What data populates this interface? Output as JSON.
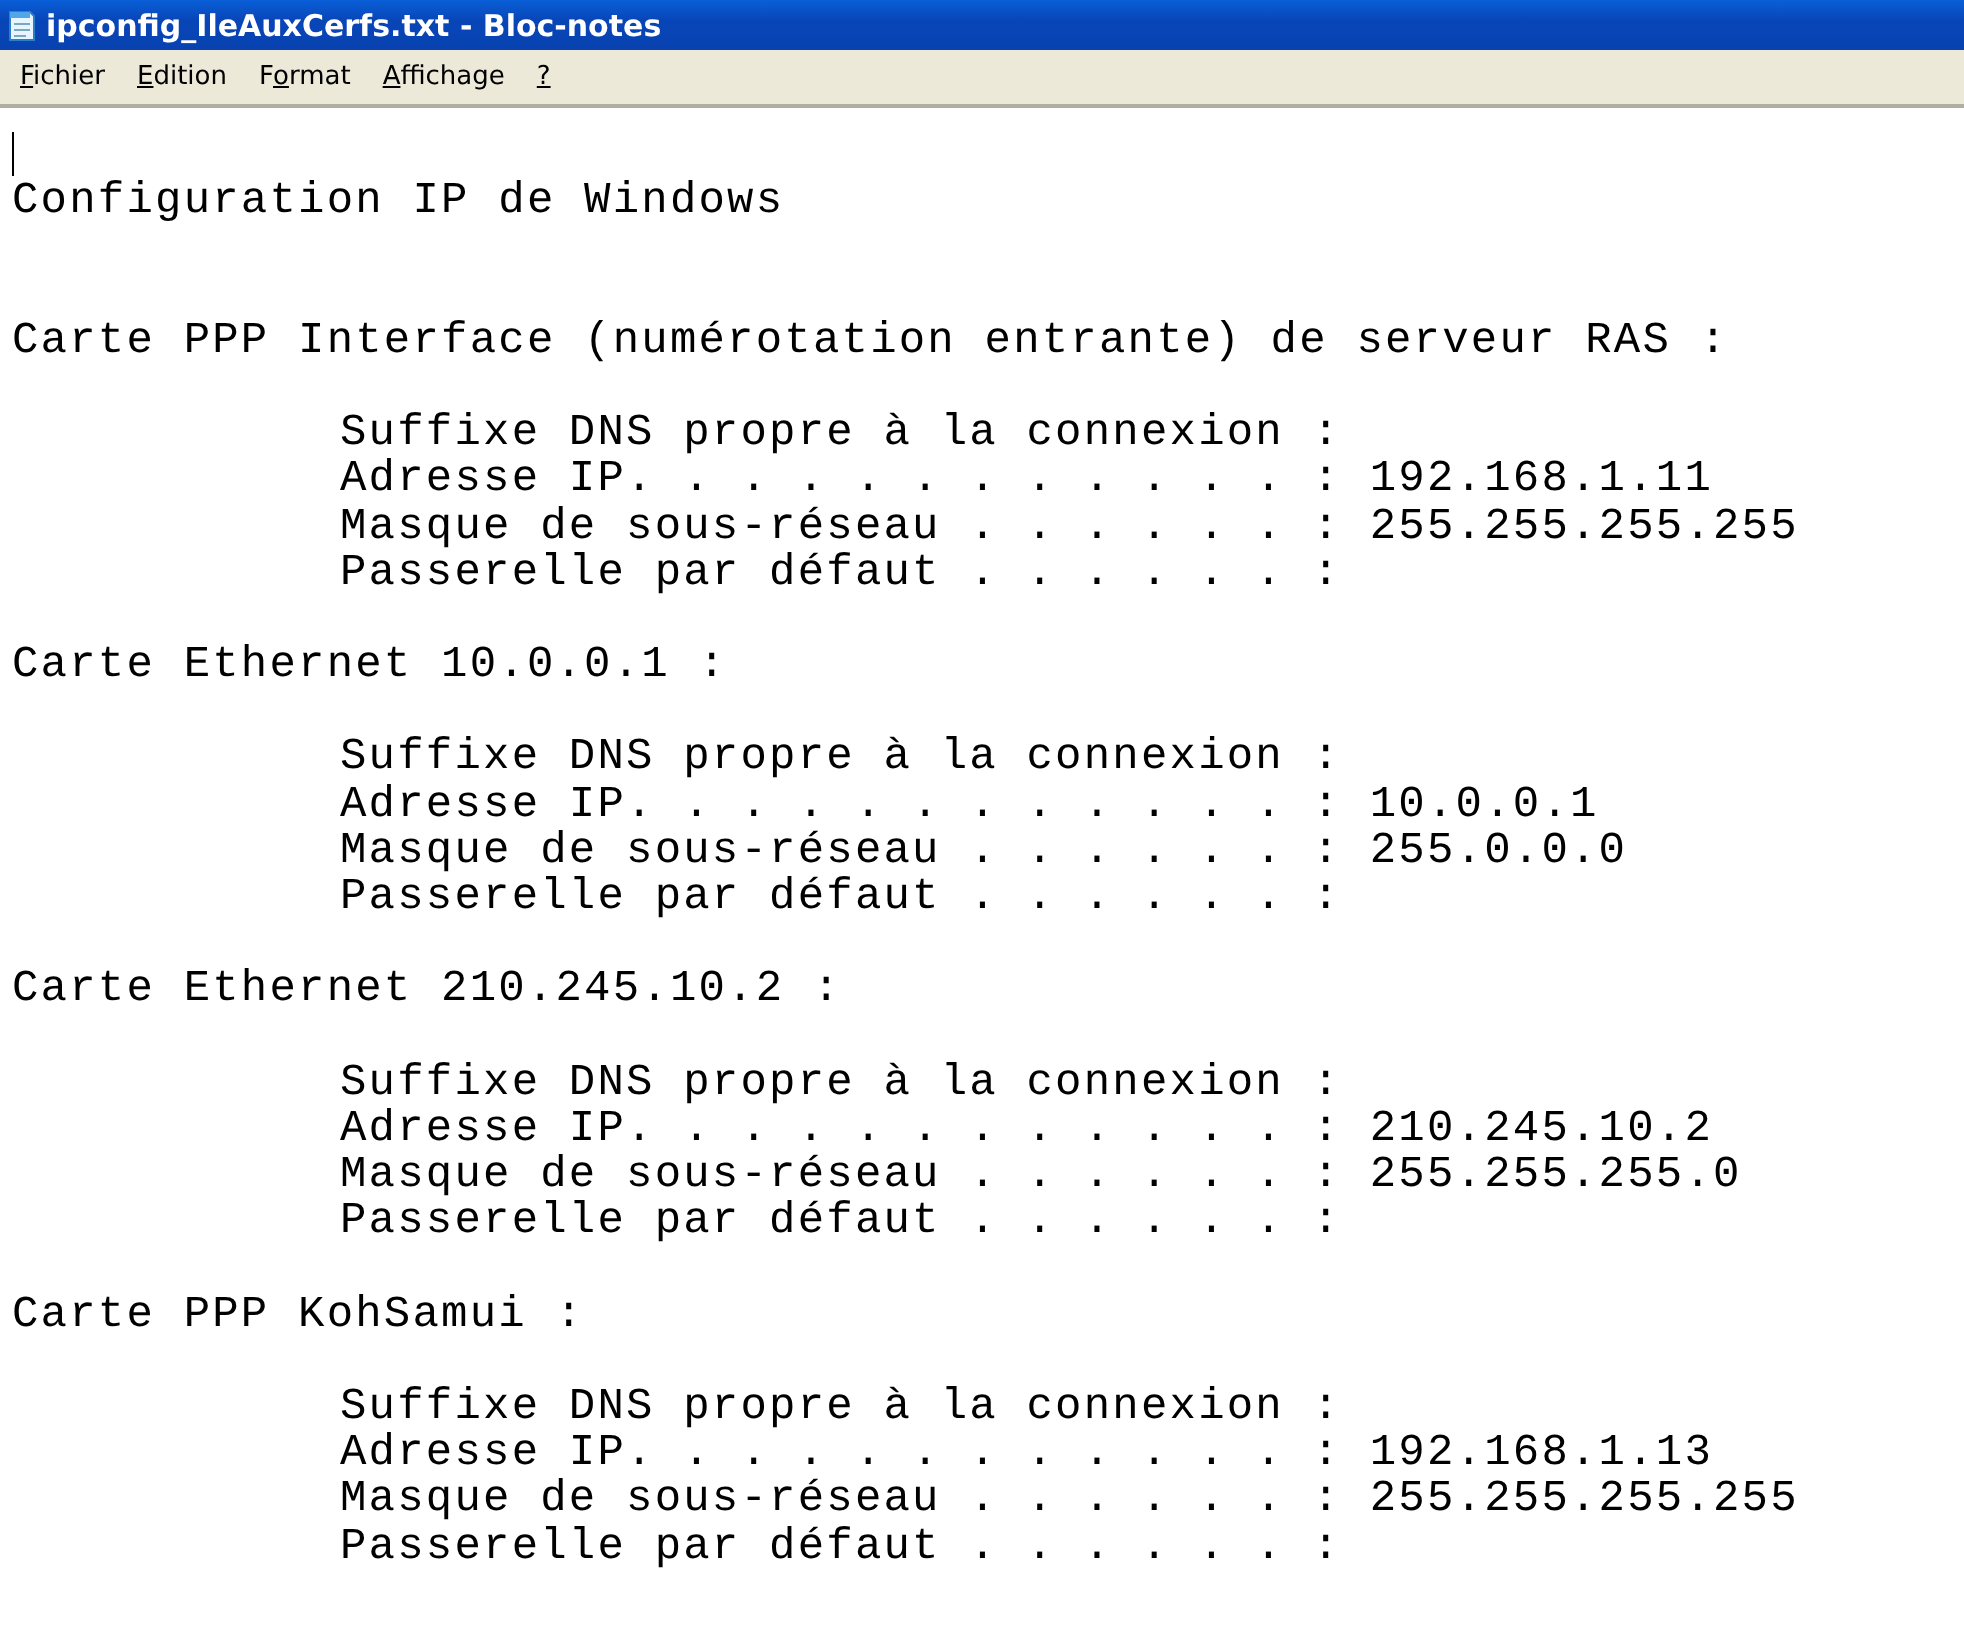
{
  "window": {
    "title": "ipconfig_IleAuxCerfs.txt - Bloc-notes"
  },
  "menu": [
    {
      "key": "F",
      "rest": "ichier"
    },
    {
      "key": "E",
      "rest": "dition"
    },
    {
      "pre": "F",
      "key": "o",
      "rest": "rmat"
    },
    {
      "key": "A",
      "rest": "ffichage"
    },
    {
      "key": "?"
    }
  ],
  "document": {
    "heading": "Configuration IP de Windows",
    "sections": [
      {
        "title": "Carte PPP Interface (numérotation entrante) de serveur RAS :",
        "lines": [
          "Suffixe DNS propre à la connexion :",
          "Adresse IP. . . . . . . . . . . . : 192.168.1.11",
          "Masque de sous-réseau . . . . . . : 255.255.255.255",
          "Passerelle par défaut . . . . . . :"
        ]
      },
      {
        "title": "Carte Ethernet 10.0.0.1 :",
        "lines": [
          "Suffixe DNS propre à la connexion :",
          "Adresse IP. . . . . . . . . . . . : 10.0.0.1",
          "Masque de sous-réseau . . . . . . : 255.0.0.0",
          "Passerelle par défaut . . . . . . :"
        ]
      },
      {
        "title": "Carte Ethernet 210.245.10.2 :",
        "lines": [
          "Suffixe DNS propre à la connexion :",
          "Adresse IP. . . . . . . . . . . . : 210.245.10.2",
          "Masque de sous-réseau . . . . . . : 255.255.255.0",
          "Passerelle par défaut . . . . . . :"
        ]
      },
      {
        "title": "Carte PPP KohSamui :",
        "lines": [
          "Suffixe DNS propre à la connexion :",
          "Adresse IP. . . . . . . . . . . . : 192.168.1.13",
          "Masque de sous-réseau . . . . . . : 255.255.255.255",
          "Passerelle par défaut . . . . . . :"
        ]
      }
    ]
  }
}
